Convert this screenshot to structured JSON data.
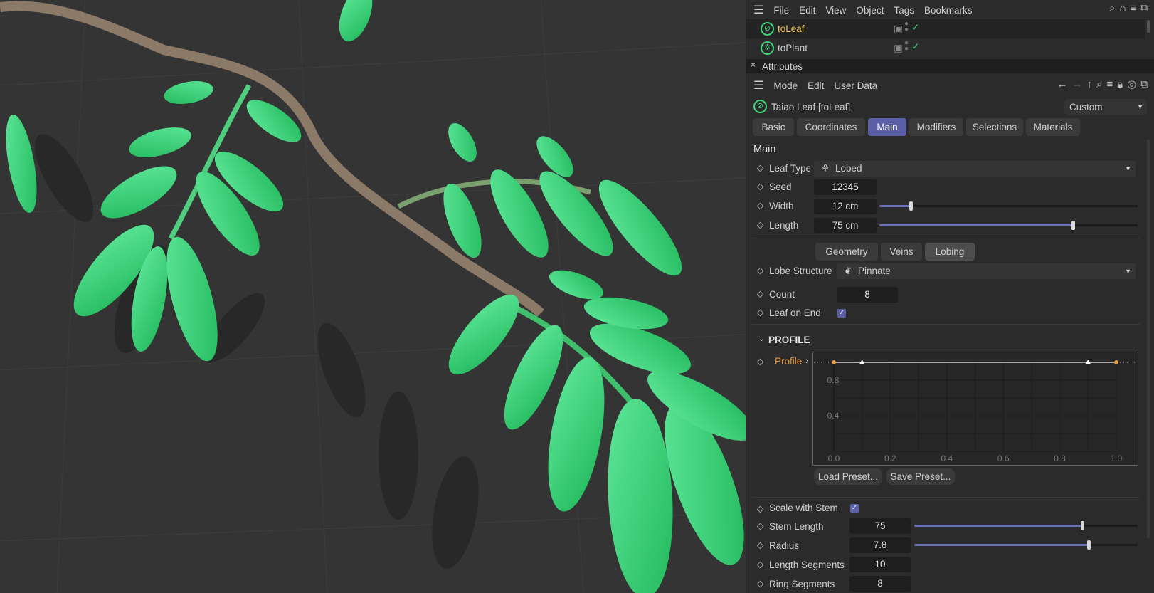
{
  "menu": {
    "items": [
      "File",
      "Edit",
      "View",
      "Object",
      "Tags",
      "Bookmarks"
    ]
  },
  "objects": [
    {
      "name": "toLeaf",
      "selected": true
    },
    {
      "name": "toPlant",
      "selected": false
    }
  ],
  "attributes": {
    "title": "Attributes",
    "menu": [
      "Mode",
      "Edit",
      "User Data"
    ],
    "object_title": "Taiao Leaf [toLeaf]",
    "preset": "Custom",
    "tabs": [
      "Basic",
      "Coordinates",
      "Main",
      "Modifiers",
      "Selections",
      "Materials"
    ],
    "active_tab": "Main",
    "section": "Main",
    "leaf_type": {
      "label": "Leaf Type",
      "value": "Lobed"
    },
    "seed": {
      "label": "Seed",
      "value": "12345"
    },
    "width": {
      "label": "Width",
      "value": "12 cm",
      "slider": 0.12
    },
    "length": {
      "label": "Length",
      "value": "75 cm",
      "slider": 0.75
    },
    "subtabs": [
      "Geometry",
      "Veins",
      "Lobing"
    ],
    "active_subtab": "Lobing",
    "lobe_structure": {
      "label": "Lobe Structure",
      "value": "Pinnate"
    },
    "count": {
      "label": "Count",
      "value": "8"
    },
    "leaf_on_end": {
      "label": "Leaf on End",
      "checked": true
    },
    "profile_section": "PROFILE",
    "profile_label": "Profile",
    "profile_chart": {
      "x_ticks": [
        "0.0",
        "0.2",
        "0.4",
        "0.6",
        "0.8",
        "1.0"
      ],
      "y_ticks": [
        "0.8",
        "0.4"
      ],
      "points": [
        [
          0,
          1
        ],
        [
          0.1,
          1
        ],
        [
          0.9,
          1
        ],
        [
          1,
          1
        ]
      ]
    },
    "load_preset": "Load Preset...",
    "save_preset": "Save Preset...",
    "scale_with_stem": {
      "label": "Scale with Stem",
      "checked": true
    },
    "stem_length": {
      "label": "Stem Length",
      "value": "75",
      "slider": 0.75
    },
    "radius": {
      "label": "Radius",
      "value": "7.8",
      "slider": 0.78
    },
    "length_segments": {
      "label": "Length Segments",
      "value": "10"
    },
    "ring_segments": {
      "label": "Ring Segments",
      "value": "8"
    }
  },
  "colors": {
    "accent": "#5b5fa6",
    "selected_text": "#f0c24a",
    "profile_label": "#e89a3c",
    "leaf": "#3fd47a"
  }
}
